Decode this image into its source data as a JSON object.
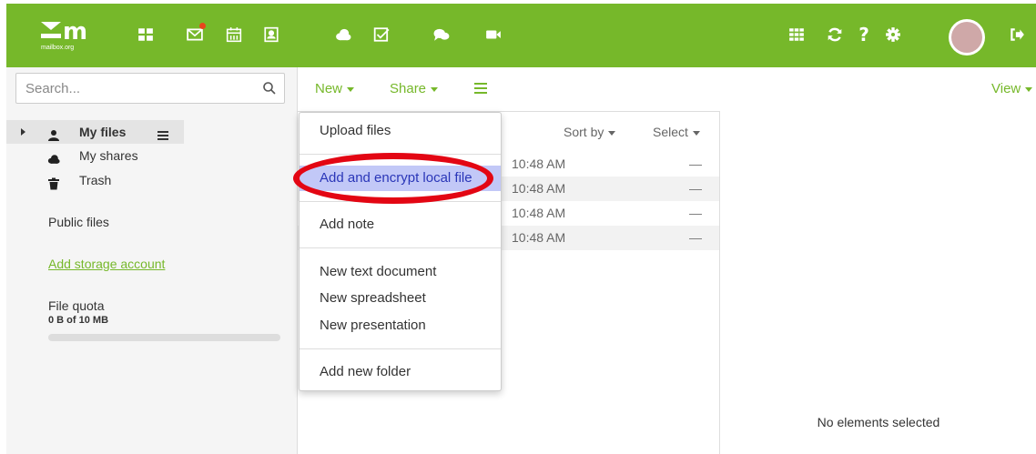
{
  "colors": {
    "brand_green": "#76b82a",
    "highlight_bg": "#c2c8f7",
    "highlight_text": "#2a36b8",
    "annotation_red": "#e30613",
    "notify_dot": "#e8451c"
  },
  "logo": {
    "mark": "m",
    "text": "mailbox.org"
  },
  "top_icons": [
    {
      "name": "portal-icon"
    },
    {
      "name": "mail-icon",
      "has_notification": true
    },
    {
      "name": "calendar-icon"
    },
    {
      "name": "contacts-icon"
    },
    {
      "name": "cloud-drive-icon"
    },
    {
      "name": "tasks-icon"
    },
    {
      "name": "chat-icon"
    },
    {
      "name": "video-icon"
    }
  ],
  "right_icons": [
    "app-launcher-icon",
    "refresh-icon",
    "help-icon",
    "settings-icon",
    "logout-icon"
  ],
  "search": {
    "placeholder": "Search..."
  },
  "sidebar": {
    "my_files": "My files",
    "my_shares": "My shares",
    "trash": "Trash",
    "public_files": "Public files",
    "add_storage": "Add storage account",
    "quota_label": "File quota",
    "quota_value": "0 B of 10 MB",
    "quota_fraction": 0
  },
  "toolbar": {
    "new_label": "New",
    "share_label": "Share",
    "view_label": "View"
  },
  "list": {
    "sort_by": "Sort by",
    "select": "Select",
    "rows": [
      {
        "time": "10:48 AM",
        "size": "—"
      },
      {
        "time": "10:48 AM",
        "size": "—"
      },
      {
        "time": "10:48 AM",
        "size": "—"
      },
      {
        "time": "10:48 AM",
        "size": "—"
      }
    ]
  },
  "details": {
    "no_selection": "No elements selected"
  },
  "new_menu": {
    "upload_files": "Upload files",
    "add_encrypt": "Add and encrypt local file",
    "add_note": "Add note",
    "new_text": "New text document",
    "new_spreadsheet": "New spreadsheet",
    "new_presentation": "New presentation",
    "add_folder": "Add new folder"
  }
}
